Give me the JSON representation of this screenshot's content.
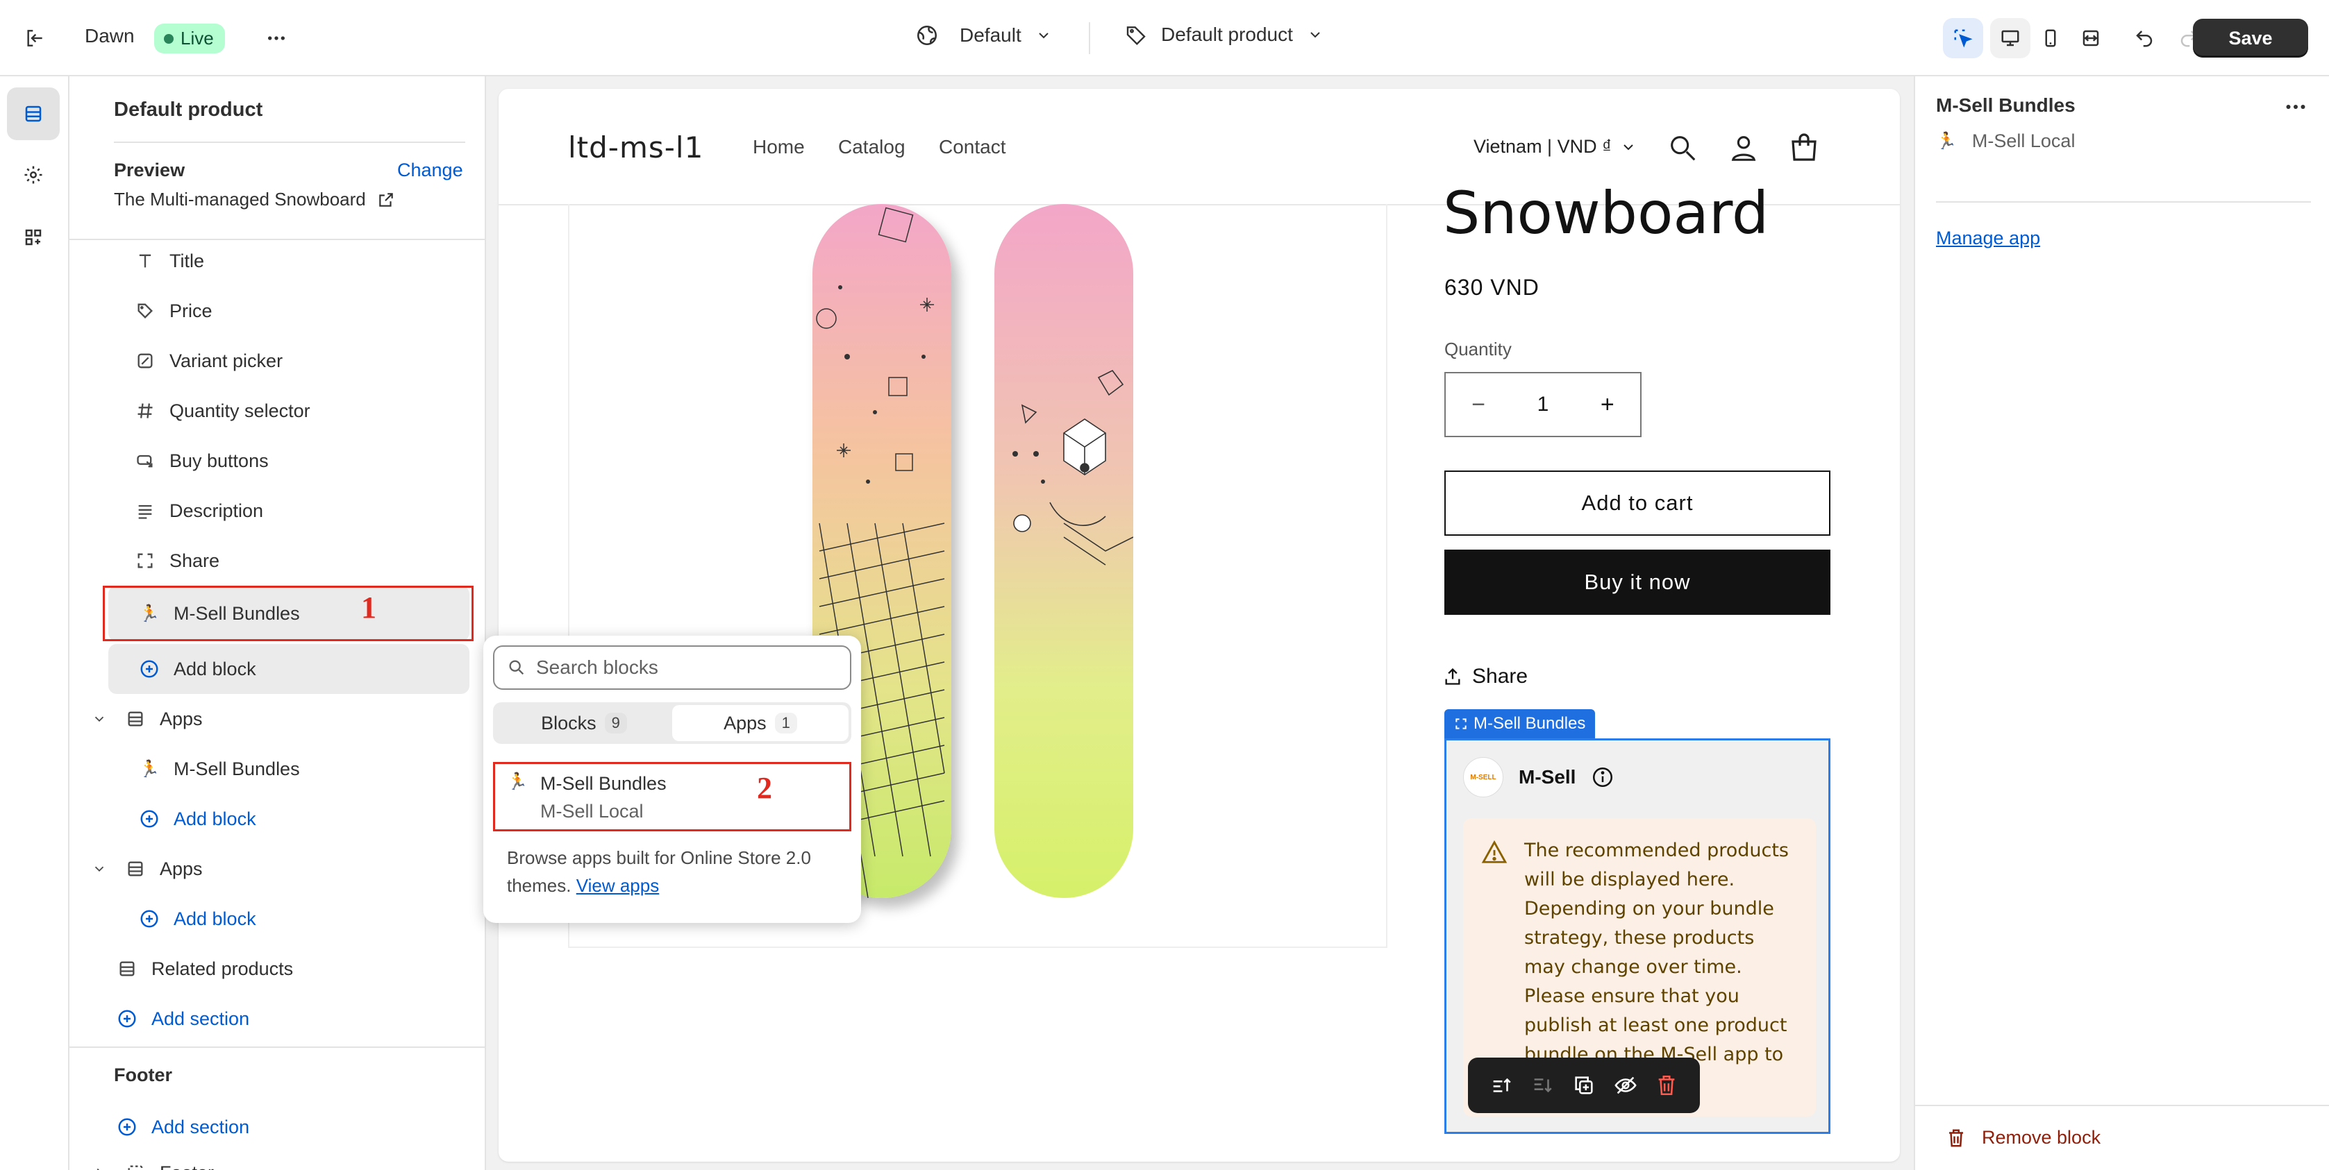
{
  "topbar": {
    "theme_name": "Dawn",
    "live_badge": "Live",
    "template_dropdown": "Default",
    "product_dropdown": "Default product",
    "save_label": "Save"
  },
  "sidebar": {
    "title": "Default product",
    "preview_label": "Preview",
    "change_label": "Change",
    "preview_product": "The Multi-managed Snowboard",
    "blocks": [
      "Title",
      "Price",
      "Variant picker",
      "Quantity selector",
      "Buy buttons",
      "Description",
      "Share"
    ],
    "selected_block": "M-Sell Bundles",
    "add_block": "Add block",
    "apps_section_1": "Apps",
    "apps_block_1": "M-Sell Bundles",
    "apps_section_2": "Apps",
    "related_products": "Related products",
    "add_section": "Add section",
    "footer_group": "Footer",
    "footer_section": "Footer"
  },
  "annotations": {
    "num1": "1",
    "num2": "2"
  },
  "popover": {
    "search_placeholder": "Search blocks",
    "tab_blocks": "Blocks",
    "tab_blocks_count": "9",
    "tab_apps": "Apps",
    "tab_apps_count": "1",
    "item_title": "M-Sell Bundles",
    "item_subtitle": "M-Sell Local",
    "footer_text": "Browse apps built for Online Store 2.0 themes.",
    "view_apps": "View apps"
  },
  "store": {
    "logo": "ltd-ms-l1",
    "nav": [
      "Home",
      "Catalog",
      "Contact"
    ],
    "locale": "Vietnam | VND ₫",
    "product_title": "Snowboard",
    "price": "630 VND",
    "quantity_label": "Quantity",
    "quantity_value": "1",
    "add_to_cart": "Add to cart",
    "buy_now": "Buy it now",
    "share": "Share",
    "msell_tag": "M-Sell Bundles",
    "msell_brand": "M-Sell",
    "msell_logo_text": "M-SELL",
    "warning_text": "The recommended products will be displayed here. Depending on your bundle strategy, these products may change over time. Please ensure that you publish at least one product bundle on the M-Sell app to activate this"
  },
  "right_panel": {
    "title": "M-Sell Bundles",
    "app_name": "M-Sell Local",
    "manage_app": "Manage app",
    "remove_block": "Remove block"
  },
  "colors": {
    "accent_blue": "#005bd3",
    "annotation_red": "#e0291f",
    "live_green": "#b4fed2",
    "warning_bg": "#fcefe5",
    "board_pink": "#f3a6c8",
    "board_green": "#d6f06a"
  }
}
